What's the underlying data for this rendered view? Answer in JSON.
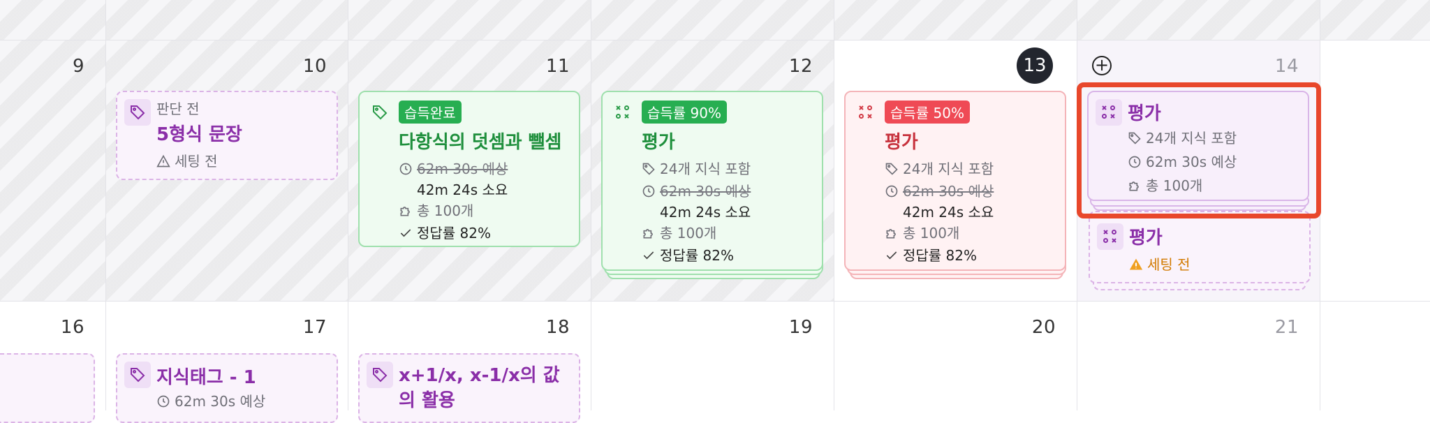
{
  "row1": {
    "days": [
      "9",
      "10",
      "11",
      "12",
      "13",
      "14"
    ]
  },
  "row2": {
    "days": [
      "16",
      "17",
      "18",
      "19",
      "20",
      "21"
    ]
  },
  "today": "13",
  "cards": {
    "c10": {
      "status": "판단 전",
      "title": "5형식 문장",
      "setting": "세팅 전"
    },
    "c11": {
      "badge": "습득완료",
      "title": "다항식의 덧셈과 뺄셈",
      "planned": "62m 30s 예상",
      "spent": "42m 24s 소요",
      "total": "총 100개",
      "accuracy": "정답률 82%"
    },
    "c12": {
      "badge": "습득률 90%",
      "title": "평가",
      "knowledge": "24개 지식 포함",
      "planned": "62m 30s 예상",
      "spent": "42m 24s 소요",
      "total": "총 100개",
      "accuracy": "정답률 82%"
    },
    "c13": {
      "badge": "습득률 50%",
      "title": "평가",
      "knowledge": "24개 지식 포함",
      "planned": "62m 30s 예상",
      "spent": "42m 24s 소요",
      "total": "총 100개",
      "accuracy": "정답률 82%"
    },
    "c14a": {
      "title": "평가",
      "knowledge": "24개 지식 포함",
      "planned": "62m 30s 예상",
      "total": "총 100개"
    },
    "c14b": {
      "title": "평가",
      "setting": "세팅 전"
    },
    "c17": {
      "title": "지식태그 - 1",
      "planned": "62m 30s 예상"
    },
    "c18": {
      "title": "x+1/x, x-1/x의 값의 활용"
    }
  },
  "icons": {
    "tag": "tag-icon",
    "eval": "evaluation-icon",
    "clock": "clock-icon",
    "puzzle": "puzzle-icon",
    "check": "check-icon",
    "warning": "warning-icon",
    "add": "add-circle-icon"
  },
  "colors": {
    "purple": "#8a2ea8",
    "green": "#27ae51",
    "red": "#ef4a55",
    "highlight": "#e8472b",
    "today_badge": "#23262e"
  }
}
